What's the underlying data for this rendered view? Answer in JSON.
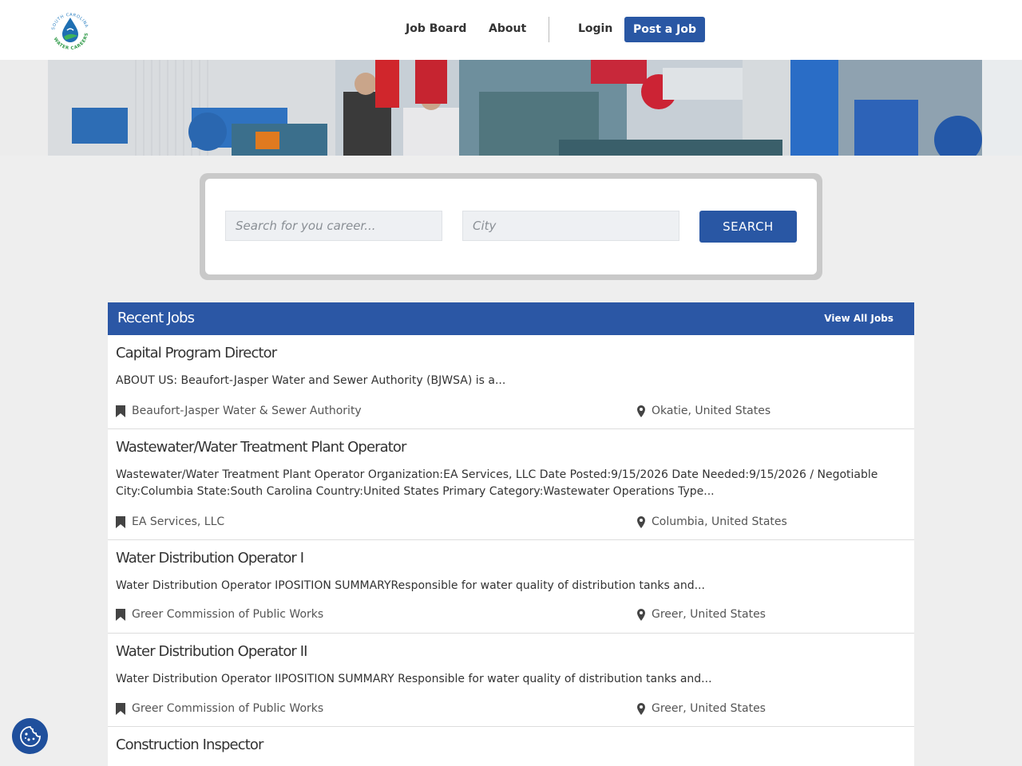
{
  "header": {
    "logo_text": "SOUTH CAROLINA WATER CAREERS",
    "nav": {
      "job_board": "Job Board",
      "about": "About",
      "login": "Login",
      "post_job": "Post a Job"
    }
  },
  "search": {
    "keyword_placeholder": "Search for you career...",
    "city_placeholder": "City",
    "button_label": "SEARCH"
  },
  "jobs": {
    "heading": "Recent Jobs",
    "view_all": "View All Jobs",
    "items": [
      {
        "title": "Capital Program Director",
        "description": "ABOUT US: Beaufort-Jasper Water and Sewer Authority (BJWSA) is a...",
        "company": "Beaufort-Jasper Water & Sewer Authority",
        "location": "Okatie, United States"
      },
      {
        "title": "Wastewater/Water Treatment Plant Operator",
        "description": "Wastewater/Water Treatment Plant Operator  Organization:EA Services, LLC Date Posted:9/15/2026 Date Needed:9/15/2026 / Negotiable City:Columbia State:South Carolina Country:United States Primary Category:Wastewater Operations Type...",
        "company": "EA Services, LLC",
        "location": "Columbia, United States"
      },
      {
        "title": "Water Distribution Operator I",
        "description": "Water Distribution Operator IPOSITION SUMMARYResponsible for water quality of distribution tanks and...",
        "company": "Greer Commission of Public Works",
        "location": "Greer, United States"
      },
      {
        "title": "Water Distribution Operator II",
        "description": "Water Distribution Operator IIPOSITION SUMMARY Responsible for water quality of distribution tanks and...",
        "company": "Greer Commission of Public Works",
        "location": "Greer, United States"
      },
      {
        "title": "Construction Inspector"
      }
    ]
  },
  "colors": {
    "brand_blue": "#2957a4",
    "page_bg": "#eeeeee"
  }
}
